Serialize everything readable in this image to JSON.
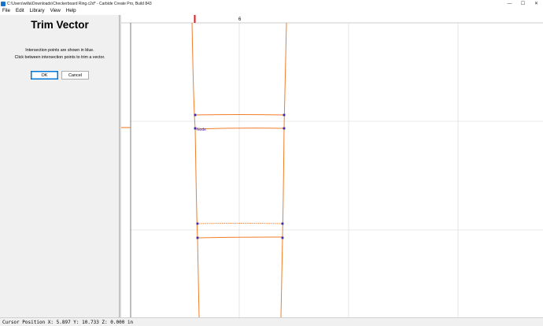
{
  "window": {
    "title": "C:\\Users\\willa\\Downloads\\Checkerboard Ring.c2d* - Carbide Create Pro, Build 843",
    "minimize_glyph": "—",
    "maximize_glyph": "☐",
    "close_glyph": "✕"
  },
  "menu": {
    "items": [
      "File",
      "Edit",
      "Library",
      "View",
      "Help"
    ]
  },
  "panel": {
    "title": "Trim Vector",
    "line1": "Intersection points are shown in blue.",
    "line2": "Click between intersection points to trim a vector.",
    "ok_label": "OK",
    "cancel_label": "Cancel"
  },
  "canvas": {
    "ruler_label": "6",
    "node_label": "Node",
    "colors": {
      "vector": "#f07e2a",
      "node": "#3b2aa8",
      "grid": "#d6d6d6",
      "axis": "#444444",
      "marker": "#e8141e"
    }
  },
  "status": {
    "text": "Cursor Position X: 5.897 Y: 10.733 Z: 0.000 in"
  }
}
